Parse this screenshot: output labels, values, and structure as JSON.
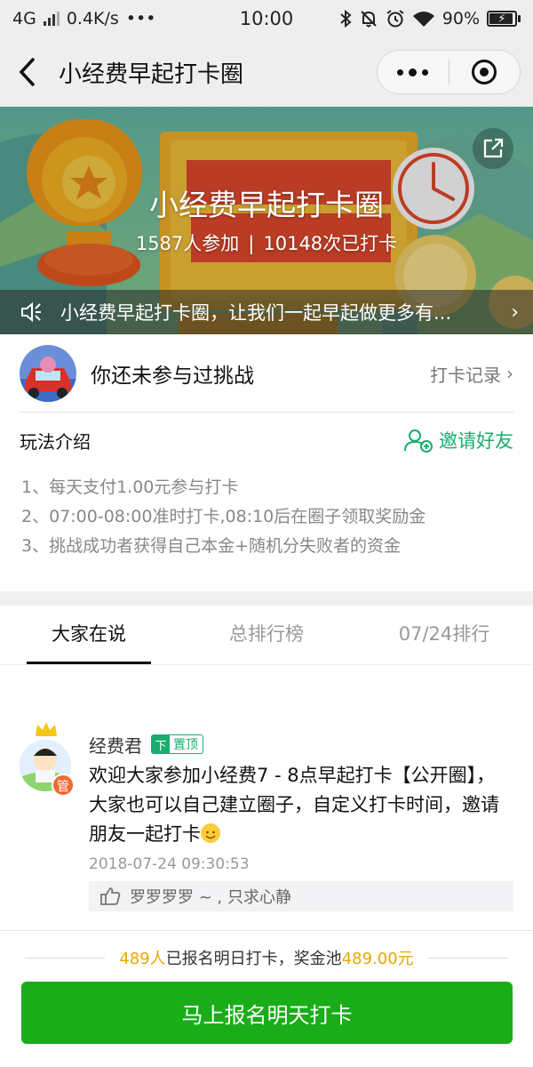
{
  "status_bar": {
    "network": "4G",
    "speed": "0.4K/s",
    "dots": "•••",
    "time": "10:00",
    "battery": "90%"
  },
  "nav": {
    "title": "小经费早起打卡圈"
  },
  "banner": {
    "title": "小经费早起打卡圈",
    "participants": "1587人参加",
    "divider": "|",
    "checkins": "10148次已打卡",
    "notice": "小经费早起打卡圈，让我们一起早起做更多有...",
    "notice_chevron": "›"
  },
  "user": {
    "status": "你还未参与过挑战",
    "record_link": "打卡记录",
    "record_chevron": "›"
  },
  "rules": {
    "title": "玩法介绍",
    "invite": "邀请好友",
    "items": [
      "1、每天支付1.00元参与打卡",
      "2、07:00-08:00准时打卡,08:10后在圈子领取奖励金",
      "3、挑战成功者获得自己本金+随机分失败者的资金"
    ]
  },
  "tabs": [
    {
      "label": "大家在说",
      "active": true
    },
    {
      "label": "总排行榜",
      "active": false
    },
    {
      "label": "07/24排行",
      "active": false
    }
  ],
  "post": {
    "author": "经费君",
    "admin_badge": "管",
    "pin_icon": "下",
    "pin_label": "置顶",
    "text": "欢迎大家参加小经费7 - 8点早起打卡【公开圈】，大家也可以自己建立圈子，自定义打卡时间，邀请朋友一起打卡",
    "time": "2018-07-24 09:30:53",
    "likes": "罗罗罗罗 ~ , 只求心静"
  },
  "footer": {
    "count": "489人",
    "mid_text": "已报名明日打卡，奖金池",
    "pool": "489.00元",
    "cta": "马上报名明天打卡"
  },
  "colors": {
    "accent_green": "#1aad19",
    "link_green": "#1aad6f",
    "gold": "#e6a800"
  }
}
